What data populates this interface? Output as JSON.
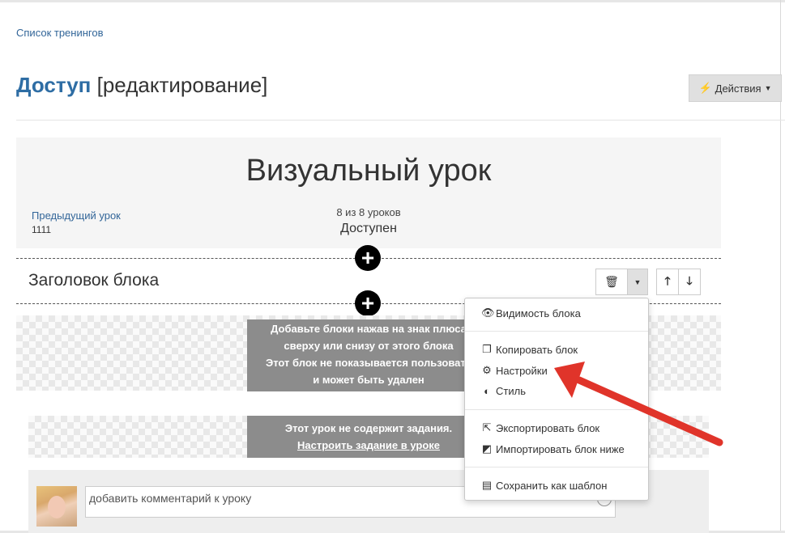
{
  "breadcrumb": "Список тренингов",
  "title": {
    "part1": "Доступ",
    "part2": "[редактирование]"
  },
  "actions": {
    "icon": "bolt-icon",
    "label": "Действия"
  },
  "lesson": {
    "title": "Визуальный урок",
    "prev_label": "Предыдущий урок",
    "prev_value": "1111",
    "progress": "8 из 8 уроков",
    "status": "Доступен"
  },
  "block": {
    "title": "Заголовок блока"
  },
  "notice_block": {
    "line1": "Добавьте блоки нажав на знак плюса",
    "line2": "сверху или снизу от этого блока",
    "line3": "Этот блок не показывается пользовате",
    "line4": "и может быть удален"
  },
  "notice_task": {
    "line1": "Этот урок не содержит задания.",
    "link": "Настроить задание в уроке"
  },
  "comment": {
    "placeholder": "добавить комментарий к уроку"
  },
  "menu": {
    "visibility": "Видимость блока",
    "copy": "Копировать блок",
    "settings": "Настройки",
    "style": "Стиль",
    "export": "Экспортировать блок",
    "import": "Импортировать блок ниже",
    "save_template": "Сохранить как шаблон"
  },
  "colors": {
    "accent": "#2e6da4",
    "link": "#336699",
    "arrow": "#e0342a",
    "notice_bg": "#8c8c8c"
  }
}
